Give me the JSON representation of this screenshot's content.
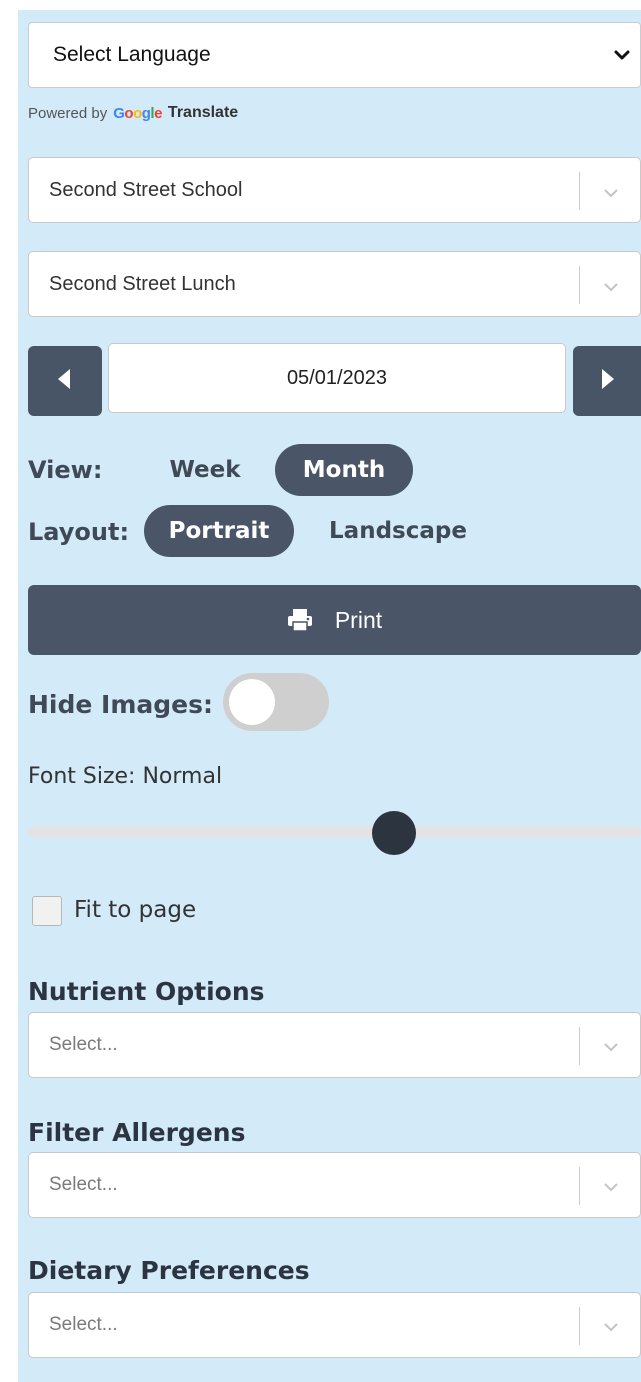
{
  "language": {
    "label": "Select Language"
  },
  "powered": {
    "prefix": "Powered by",
    "brand": "Google",
    "suffix": "Translate"
  },
  "school_select": {
    "value": "Second Street School"
  },
  "menu_select": {
    "value": "Second Street Lunch"
  },
  "date_nav": {
    "date": "05/01/2023"
  },
  "view": {
    "label": "View:",
    "options": [
      "Week",
      "Month"
    ],
    "selected": "Month"
  },
  "layout": {
    "label": "Layout:",
    "options": [
      "Portrait",
      "Landscape"
    ],
    "selected": "Portrait"
  },
  "print": {
    "label": "Print"
  },
  "hide_images": {
    "label": "Hide Images:",
    "enabled": false
  },
  "font_size": {
    "label": "Font Size: Normal",
    "level_fraction": 0.59
  },
  "fit_to_page": {
    "label": "Fit to page",
    "checked": false
  },
  "nutrient_options": {
    "heading": "Nutrient Options",
    "placeholder": "Select..."
  },
  "filter_allergens": {
    "heading": "Filter Allergens",
    "placeholder": "Select..."
  },
  "dietary_preferences": {
    "heading": "Dietary Preferences",
    "placeholder": "Select..."
  },
  "colors": {
    "panel_bg": "#d3eaf9",
    "accent_dark": "#4a5667",
    "google_blue": "#4285f4",
    "google_red": "#ea4335",
    "google_yellow": "#fbbc05",
    "google_green": "#34a853"
  }
}
